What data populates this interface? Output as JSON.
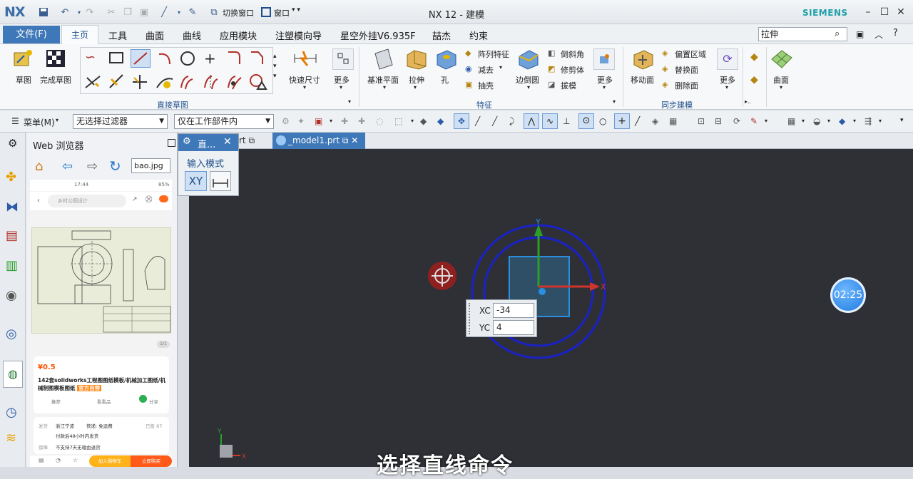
{
  "titlebar": {
    "logo": "NX",
    "title": "NX 12 - 建模",
    "brand": "SIEMENS",
    "switch_window": "切换窗口",
    "window_menu": "窗口"
  },
  "menu": {
    "file": "文件(F)",
    "tabs": [
      "主页",
      "工具",
      "曲面",
      "曲线",
      "应用模块",
      "注塑模向导",
      "星空外挂V6.935F",
      "喆杰",
      "约束"
    ],
    "search": "拉伸"
  },
  "ribbon": {
    "sketch": "草图",
    "finish_sketch": "完成草图",
    "quick_dim": "快速尺寸",
    "more1": "更多",
    "group_direct_sketch": "直接草图",
    "datum_plane": "基准平面",
    "extrude": "拉伸",
    "hole": "孔",
    "pattern": "阵列特征",
    "subtract": "减去",
    "shell": "抽壳",
    "edge_blend": "边倒圆",
    "chamfer": "倒斜角",
    "trim_body": "修剪体",
    "draft": "拔模",
    "more2": "更多",
    "group_feature": "特征",
    "move_face": "移动面",
    "offset_region": "偏置区域",
    "replace_face": "替换面",
    "delete_face": "删除面",
    "more3": "更多",
    "group_sync": "同步建模",
    "surface": "曲面"
  },
  "toolbar2": {
    "menu": "菜单(M)",
    "filter": "无选择过滤器",
    "scope": "仅在工作部件内"
  },
  "webbrowser": {
    "title": "Web 浏览器",
    "url": "bao.jpg",
    "phone": {
      "time": "17:44",
      "battery": "85%",
      "search": "乡村公厕设计",
      "price": "¥0.5",
      "product_title": "142套solidworks工程图图纸模板/机械加工图纸/机械制图模板图纸",
      "tag": "官方自营",
      "like": "推荐",
      "watch": "看看品",
      "share": "分享",
      "ship_label": "发货",
      "ship_from": "浙江宁波",
      "delivery": "快递: 免运费",
      "sold": "已售 87",
      "ship_time": "付款后48小时内发货",
      "guarantee_label": "保障",
      "guarantee": "不支持7天无理由退货",
      "add_cart": "加入购物车",
      "buy_now": "立即购买",
      "page": "1/1"
    }
  },
  "graphics": {
    "tab_prev": "rt",
    "tab_model": "_model1.prt"
  },
  "dialog": {
    "title": "直...",
    "mode_label": "输入模式",
    "xy": "XY"
  },
  "coords": {
    "xc_label": "XC",
    "xc": "-34",
    "yc_label": "YC",
    "yc": "4"
  },
  "axes": {
    "x": "X",
    "y": "Y"
  },
  "timer": "02:25",
  "subtitle": "选择直线命令",
  "colors": {
    "accent": "#3f78b8",
    "canvas": "#2e3036",
    "circle": "#1a22c8",
    "rect": "#2a8fe0"
  }
}
